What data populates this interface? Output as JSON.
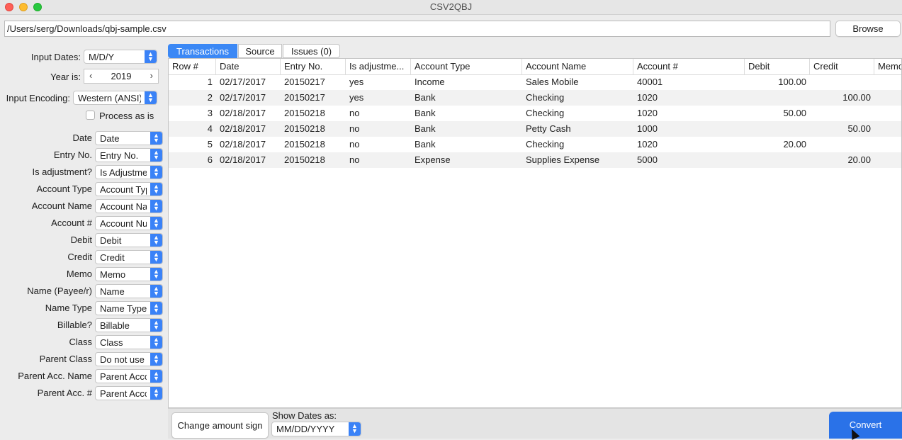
{
  "window": {
    "title": "CSV2QBJ"
  },
  "file_path": "/Users/serg/Downloads/qbj-sample.csv",
  "browse_label": "Browse",
  "settings": {
    "input_dates_label": "Input Dates:",
    "input_dates_value": "M/D/Y",
    "year_label": "Year is:",
    "year_value": "2019",
    "encoding_label": "Input Encoding:",
    "encoding_value": "Western (ANSI)",
    "process_as_is_label": "Process as is",
    "process_as_is_checked": false
  },
  "mappings": [
    {
      "label": "Date",
      "value": "Date"
    },
    {
      "label": "Entry No.",
      "value": "Entry No."
    },
    {
      "label": "Is adjustment?",
      "value": "Is Adjustment?"
    },
    {
      "label": "Account Type",
      "value": "Account Type"
    },
    {
      "label": "Account Name",
      "value": "Account Name"
    },
    {
      "label": "Account #",
      "value": "Account Number"
    },
    {
      "label": "Debit",
      "value": "Debit"
    },
    {
      "label": "Credit",
      "value": "Credit"
    },
    {
      "label": "Memo",
      "value": "Memo"
    },
    {
      "label": "Name (Payee/r)",
      "value": "Name"
    },
    {
      "label": "Name Type",
      "value": "Name Type"
    },
    {
      "label": "Billable?",
      "value": "Billable"
    },
    {
      "label": "Class",
      "value": "Class"
    },
    {
      "label": "Parent Class",
      "value": "Do not use"
    },
    {
      "label": "Parent Acc. Name",
      "value": "Parent Account Name"
    },
    {
      "label": "Parent Acc. #",
      "value": "Parent Account Number"
    }
  ],
  "tabs": [
    {
      "label": "Transactions",
      "active": true
    },
    {
      "label": "Source",
      "active": false
    },
    {
      "label": "Issues (0)",
      "active": false
    }
  ],
  "table": {
    "columns": [
      "Row #",
      "Date",
      "Entry No.",
      "Is adjustme...",
      "Account Type",
      "Account Name",
      "Account #",
      "Debit",
      "Credit",
      "Memo"
    ],
    "rows": [
      [
        "1",
        "02/17/2017",
        "20150217",
        "yes",
        "Income",
        "Sales Mobile",
        "40001",
        "100.00",
        "",
        ""
      ],
      [
        "2",
        "02/17/2017",
        "20150217",
        "yes",
        "Bank",
        "Checking",
        "1020",
        "",
        "100.00",
        ""
      ],
      [
        "3",
        "02/18/2017",
        "20150218",
        "no",
        "Bank",
        "Checking",
        "1020",
        "50.00",
        "",
        ""
      ],
      [
        "4",
        "02/18/2017",
        "20150218",
        "no",
        "Bank",
        "Petty Cash",
        "1000",
        "",
        "50.00",
        ""
      ],
      [
        "5",
        "02/18/2017",
        "20150218",
        "no",
        "Bank",
        "Checking",
        "1020",
        "20.00",
        "",
        ""
      ],
      [
        "6",
        "02/18/2017",
        "20150218",
        "no",
        "Expense",
        "Supplies Expense",
        "5000",
        "",
        "20.00",
        ""
      ]
    ]
  },
  "bottom": {
    "change_sign_label": "Change amount sign",
    "show_dates_label": "Show Dates as:",
    "show_dates_value": "MM/DD/YYYY",
    "convert_label": "Convert"
  },
  "colors": {
    "accent": "#3a82f7",
    "convert": "#2a72e8"
  }
}
